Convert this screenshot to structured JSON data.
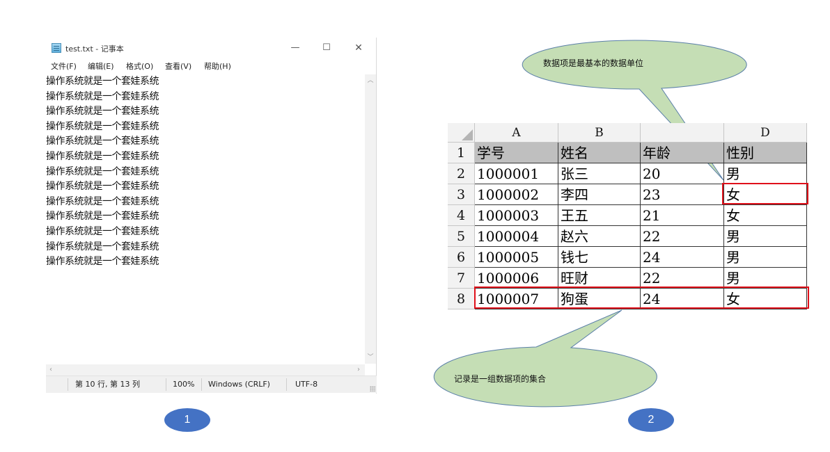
{
  "notepad": {
    "title": "test.txt - 记事本",
    "window_buttons": {
      "minimize": "—",
      "maximize": "☐",
      "close": "✕"
    },
    "menu": [
      "文件(F)",
      "编辑(E)",
      "格式(O)",
      "查看(V)",
      "帮助(H)"
    ],
    "lines": [
      "操作系统就是一个套娃系统",
      "操作系统就是一个套娃系统",
      "操作系统就是一个套娃系统",
      "操作系统就是一个套娃系统",
      "操作系统就是一个套娃系统",
      "操作系统就是一个套娃系统",
      "操作系统就是一个套娃系统",
      "操作系统就是一个套娃系统",
      "操作系统就是一个套娃系统",
      "操作系统就是一个套娃系统",
      "操作系统就是一个套娃系统",
      "操作系统就是一个套娃系统",
      "操作系统就是一个套娃系统"
    ],
    "status": {
      "position": "第 10 行, 第 13 列",
      "zoom": "100%",
      "line_ending": "Windows (CRLF)",
      "encoding": "UTF-8"
    }
  },
  "badges": {
    "left": "1",
    "right": "2"
  },
  "sheet": {
    "columns": [
      "A",
      "B",
      "",
      "D"
    ],
    "row_numbers": [
      "1",
      "2",
      "3",
      "4",
      "5",
      "6",
      "7",
      "8"
    ],
    "rows": [
      [
        "学号",
        "姓名",
        "年龄",
        "性别"
      ],
      [
        "1000001",
        "张三",
        "20",
        "男"
      ],
      [
        "1000002",
        "李四",
        "23",
        "女"
      ],
      [
        "1000003",
        "王五",
        "21",
        "女"
      ],
      [
        "1000004",
        "赵六",
        "22",
        "男"
      ],
      [
        "1000005",
        "钱七",
        "24",
        "男"
      ],
      [
        "1000006",
        "旺财",
        "22",
        "男"
      ],
      [
        "1000007",
        "狗蛋",
        "24",
        "女"
      ]
    ]
  },
  "callouts": {
    "top": "数据项是最基本的数据单位",
    "bottom": "记录是一组数据项的集合"
  },
  "colors": {
    "callout_fill": "#c5deb5",
    "callout_stroke": "#5a7fa8",
    "highlight": "#e0101a",
    "badge": "#4472c4"
  }
}
